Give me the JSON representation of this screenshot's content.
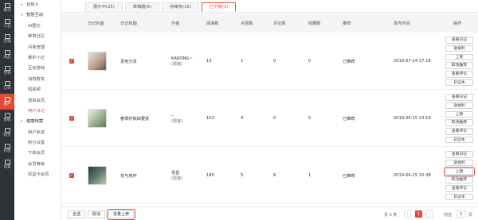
{
  "rail": [
    {
      "label": "概况",
      "icon": "overview-icon"
    },
    {
      "label": "工台",
      "icon": "workbench-icon"
    },
    {
      "label": "店铺",
      "icon": "store-icon"
    },
    {
      "label": "商品",
      "icon": "goods-icon"
    },
    {
      "label": "营销",
      "icon": "marketing-icon"
    },
    {
      "label": "订单",
      "icon": "order-icon"
    },
    {
      "label": "客户",
      "icon": "customer-icon",
      "active": true
    },
    {
      "label": "数据",
      "icon": "data-icon"
    },
    {
      "label": "财务",
      "icon": "finance-icon"
    },
    {
      "label": "开放",
      "icon": "open-icon"
    },
    {
      "label": "设置",
      "icon": "settings-icon"
    }
  ],
  "submenu": [
    {
      "label": "合伙人",
      "group": true
    },
    {
      "label": "智慧互动",
      "group": true,
      "expanded": true
    },
    {
      "label": "AI雷达"
    },
    {
      "label": "种草社区"
    },
    {
      "label": "问答管理"
    },
    {
      "label": "推护小记"
    },
    {
      "label": "互动游戏"
    },
    {
      "label": "消息群发"
    },
    {
      "label": "短视频"
    },
    {
      "label": "虚拟会员"
    },
    {
      "label": "用户日记",
      "active": true
    },
    {
      "label": "健康档案",
      "group": true
    },
    {
      "label": "用户轨迹"
    },
    {
      "label": "积分设置"
    },
    {
      "label": "下单会员"
    },
    {
      "label": "会员等级"
    },
    {
      "label": "权益卡会员"
    }
  ],
  "tabs": [
    "展示中(25)",
    "草稿箱(6)",
    "待审核(16)",
    "已下架(3)"
  ],
  "active_tab": 3,
  "columns": [
    "日记封面",
    "日记标题",
    "作者",
    "阅读数",
    "点赞数",
    "评论数",
    "收藏数",
    "推荐",
    "发布时间",
    "操作"
  ],
  "rows": [
    {
      "title": "发色分享",
      "author": "KARONG~",
      "author_sub": "(顾客)",
      "reads": "13",
      "likes": "1",
      "comments": "0",
      "favorites": "0",
      "recommend": "已推荐",
      "time": "2019-07-24 17:18",
      "ops": [
        "查看日记",
        "送福利",
        "上架",
        "取消推荐",
        "查看评论",
        "日记本"
      ]
    },
    {
      "title": "春季护肤四要素",
      "author": "--",
      "author_sub": "(顾客)",
      "reads": "102",
      "likes": "4",
      "comments": "0",
      "favorites": "0",
      "recommend": "已推荐",
      "time": "2019-04-15 23:19",
      "ops": [
        "查看日记",
        "送福利",
        "上架",
        "取消推荐",
        "查看评论",
        "日记本"
      ]
    },
    {
      "title": "花与荒杯",
      "author": "零星",
      "author_sub": "(顾客)",
      "reads": "185",
      "likes": "5",
      "comments": "8",
      "favorites": "1",
      "recommend": "已推荐",
      "time": "2019-04-15 10:38",
      "ops": [
        "查看日记",
        "送福利",
        "上架",
        "取消推荐",
        "查看评论",
        "日记本"
      ],
      "highlight_op": 2
    }
  ],
  "footer": {
    "select_all": "全选",
    "cancel": "取消",
    "batch_shelve": "批量上架",
    "total": "共 3 条",
    "prev": "‹",
    "page": "1",
    "next": "›",
    "goto_prefix": "前往",
    "goto_value": "1",
    "goto_suffix": "页"
  },
  "colors": {
    "accent": "#e04a37",
    "rail_bg": "#2f3237"
  }
}
